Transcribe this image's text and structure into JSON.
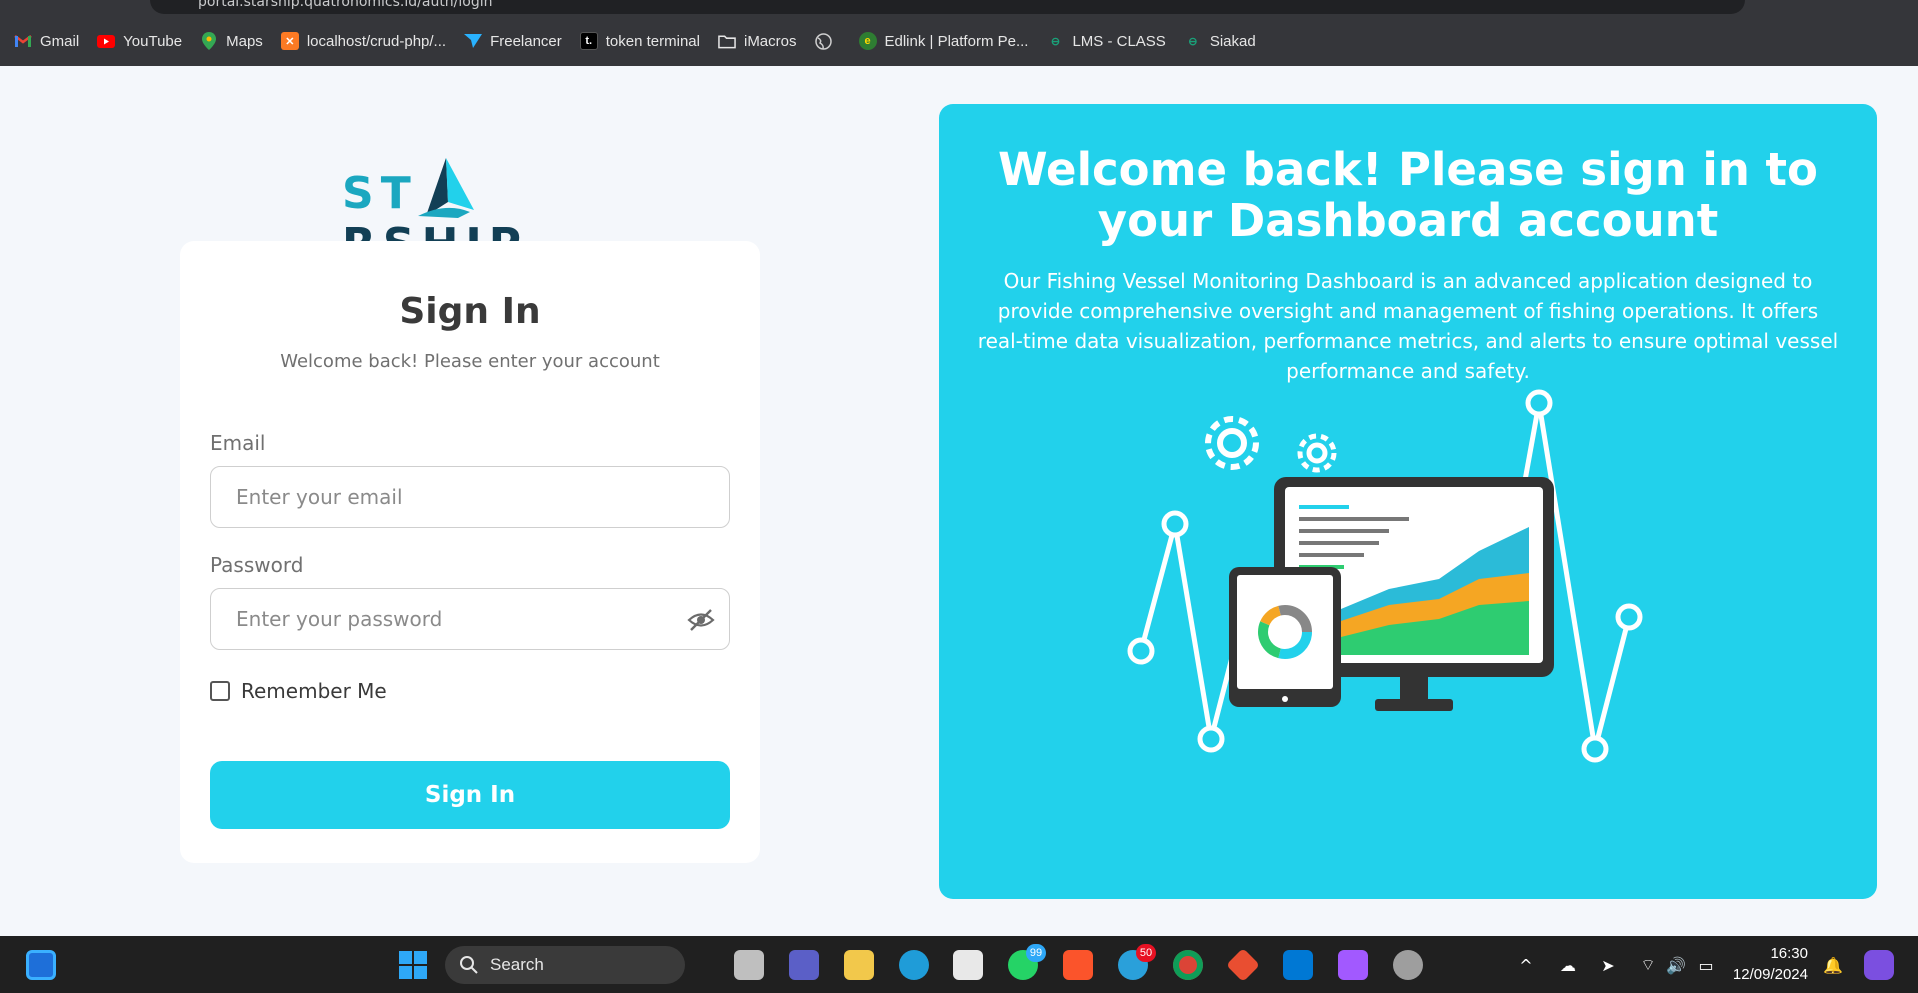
{
  "browser": {
    "url": "portal.starship.quatronomics.id/auth/login",
    "bookmarks": [
      {
        "label": "Gmail",
        "icon": "gmail-icon",
        "color": "#ea4335"
      },
      {
        "label": "YouTube",
        "icon": "youtube-icon",
        "color": "#ff0000"
      },
      {
        "label": "Maps",
        "icon": "maps-icon",
        "color": "#34a853"
      },
      {
        "label": "localhost/crud-php/...",
        "icon": "xampp-icon",
        "color": "#fb7a24"
      },
      {
        "label": "Freelancer",
        "icon": "freelancer-icon",
        "color": "#29b2fe"
      },
      {
        "label": "token terminal",
        "icon": "token-terminal-icon",
        "color": "#000000"
      },
      {
        "label": "iMacros",
        "icon": "folder-icon",
        "color": "#e6e6e6"
      },
      {
        "label": "",
        "icon": "globe-icon",
        "color": "#cfcfcf"
      },
      {
        "label": "Edlink | Platform Pe...",
        "icon": "edlink-icon",
        "color": "#2e7d32"
      },
      {
        "label": "LMS - CLASS",
        "icon": "lms-icon",
        "color": "#1aa179"
      },
      {
        "label": "Siakad",
        "icon": "siakad-icon",
        "color": "#1aa179"
      }
    ]
  },
  "brand": {
    "name_prefix": "ST",
    "name_suffix": "RSHIP",
    "accent_color": "#22d1eb",
    "dark_color": "#123f55"
  },
  "signin": {
    "title": "Sign In",
    "subtitle": "Welcome back! Please enter your account",
    "email_label": "Email",
    "email_placeholder": "Enter your email",
    "password_label": "Password",
    "password_placeholder": "Enter your password",
    "remember_label": "Remember Me",
    "remember_checked": false,
    "button_label": "Sign In"
  },
  "hero": {
    "title": "Welcome back! Please sign in to your Dashboard account",
    "description": "Our Fishing Vessel Monitoring Dashboard is an advanced application designed to provide comprehensive oversight and management of fishing operations. It offers real-time data visualization, performance metrics, and alerts to ensure optimal vessel performance and safety."
  },
  "taskbar": {
    "search_label": "Search",
    "whatsapp_badge": "99",
    "telegram_badge": "50",
    "time": "16:30",
    "date": "12/09/2024"
  }
}
